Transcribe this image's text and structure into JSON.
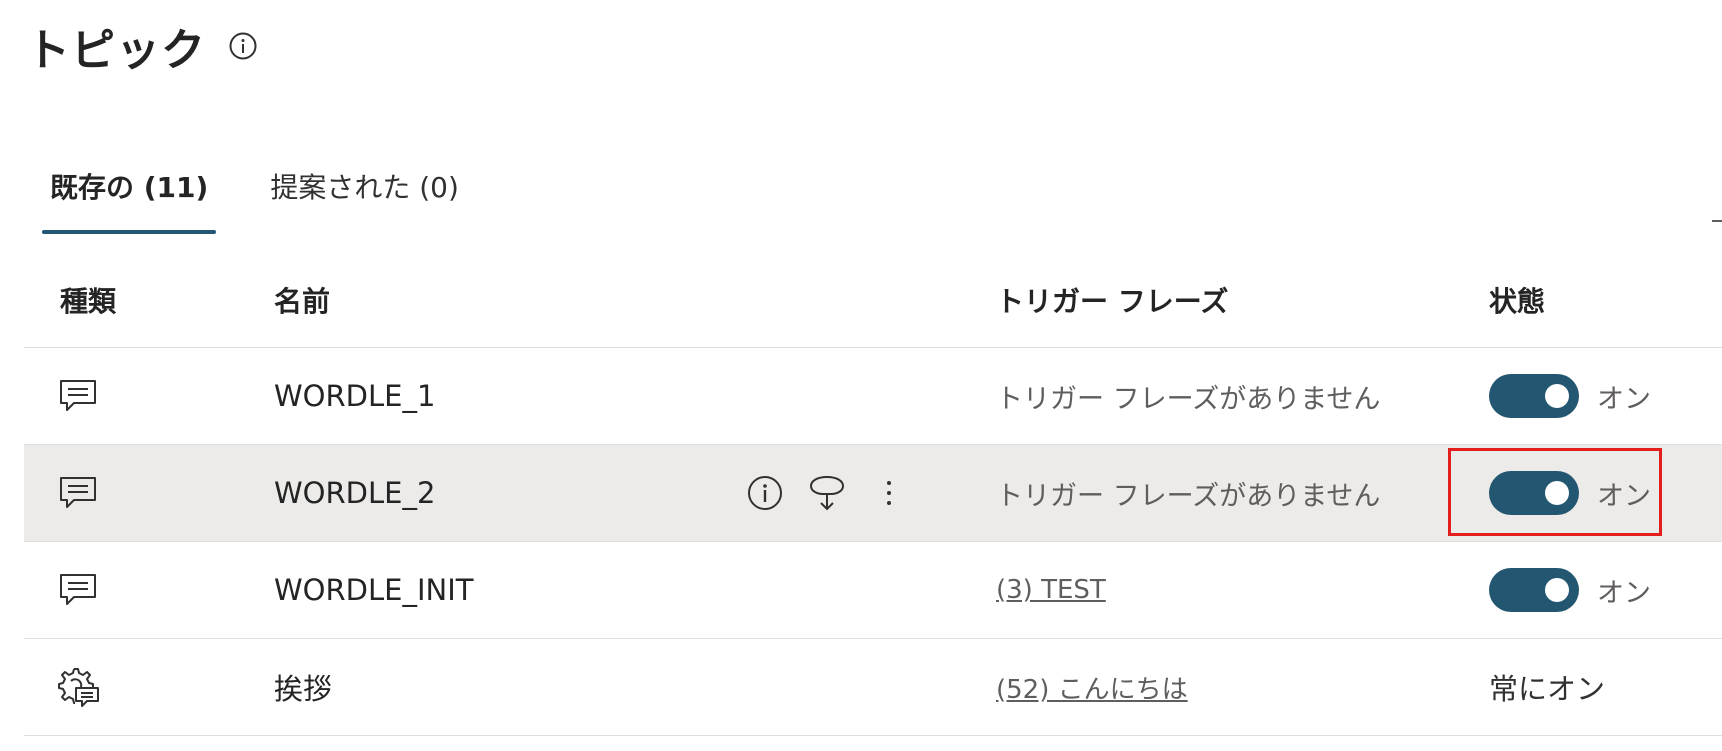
{
  "header": {
    "title": "トピック",
    "info_icon": "info-circle-icon"
  },
  "tabs": [
    {
      "label": "既存の (11)",
      "active": true
    },
    {
      "label": "提案された (0)",
      "active": false
    }
  ],
  "table": {
    "columns": {
      "type": "種類",
      "name": "名前",
      "trigger": "トリガー フレーズ",
      "status": "状態"
    },
    "rows": [
      {
        "type_icon": "chat-bubble-icon",
        "name": "WORDLE_1",
        "trigger": "トリガー フレーズがありません",
        "trigger_is_link": false,
        "status": "オン",
        "status_kind": "toggle"
      },
      {
        "type_icon": "chat-bubble-icon",
        "name": "WORDLE_2",
        "trigger": "トリガー フレーズがありません",
        "trigger_is_link": false,
        "status": "オン",
        "status_kind": "toggle",
        "hovered": true,
        "row_actions": [
          "info-circle-icon",
          "download-bubble-icon",
          "more-vertical-icon"
        ]
      },
      {
        "type_icon": "chat-bubble-icon",
        "name": "WORDLE_INIT",
        "trigger": "(3) TEST",
        "trigger_is_link": true,
        "status": "オン",
        "status_kind": "toggle"
      },
      {
        "type_icon": "gear-chat-icon",
        "name": "挨拶",
        "trigger": "(52) こんにちは",
        "trigger_is_link": true,
        "status": "常にオン",
        "status_kind": "text"
      }
    ]
  },
  "colors": {
    "accent": "#235670",
    "highlight": "#e31c1c",
    "hover_row": "#edebe9"
  }
}
